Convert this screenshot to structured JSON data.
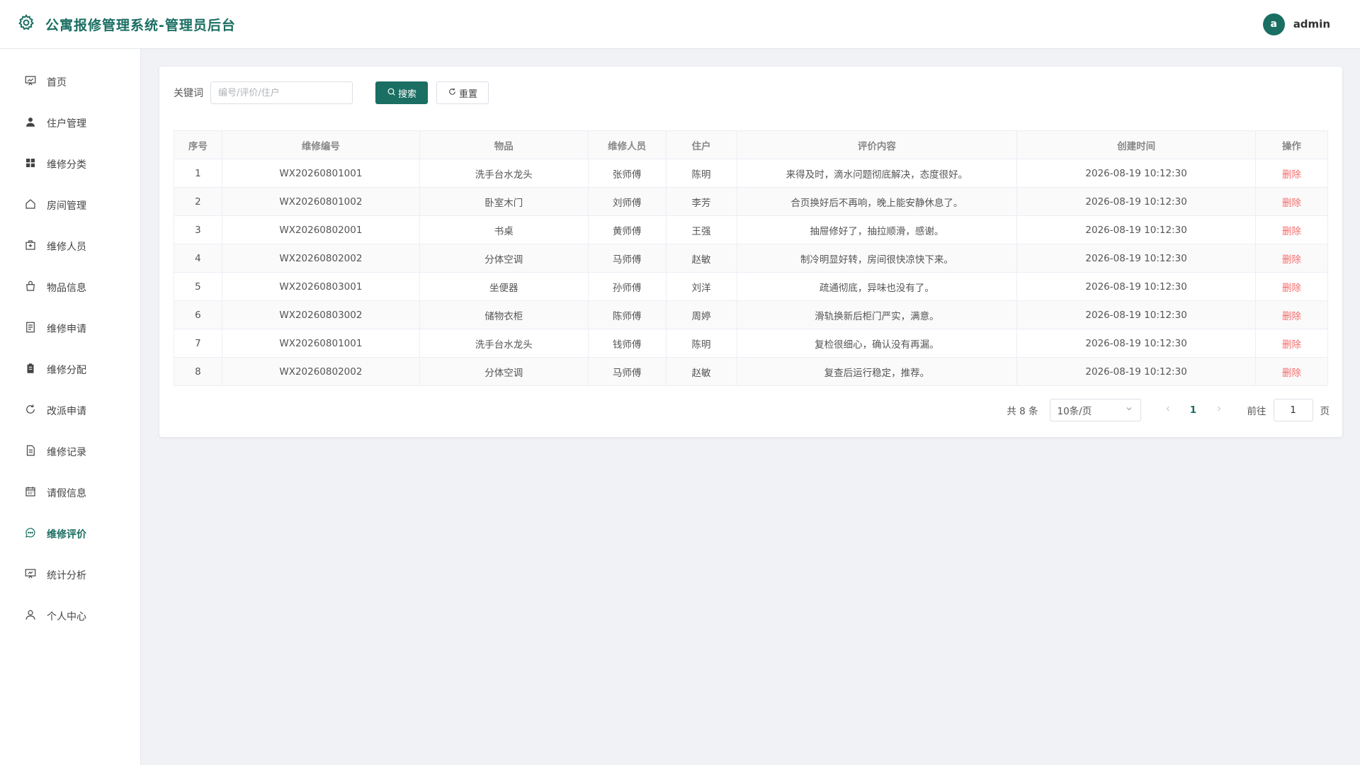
{
  "app": {
    "title": "公寓报修管理系统-管理员后台"
  },
  "user": {
    "initial": "a",
    "name": "admin"
  },
  "colors": {
    "primary": "#1a6e62",
    "danger": "#f56c6c"
  },
  "sidebar": {
    "items": [
      {
        "label": "首页",
        "icon": "chart-board-icon"
      },
      {
        "label": "住户管理",
        "icon": "user-filled-icon"
      },
      {
        "label": "维修分类",
        "icon": "grid-icon"
      },
      {
        "label": "房间管理",
        "icon": "house-icon"
      },
      {
        "label": "维修人员",
        "icon": "medical-kit-icon"
      },
      {
        "label": "物品信息",
        "icon": "shopping-bag-icon"
      },
      {
        "label": "维修申请",
        "icon": "document-icon"
      },
      {
        "label": "维修分配",
        "icon": "clipboard-icon"
      },
      {
        "label": "改派申请",
        "icon": "refresh-icon"
      },
      {
        "label": "维修记录",
        "icon": "file-text-icon"
      },
      {
        "label": "请假信息",
        "icon": "calendar-icon"
      },
      {
        "label": "维修评价",
        "icon": "chat-dots-icon"
      },
      {
        "label": "统计分析",
        "icon": "presentation-icon"
      },
      {
        "label": "个人中心",
        "icon": "user-icon"
      }
    ],
    "active_index": 11
  },
  "search": {
    "label": "关键词",
    "placeholder": "编号/评价/住户",
    "value": "",
    "search_label": "搜索",
    "reset_label": "重置"
  },
  "table": {
    "columns": [
      "序号",
      "维修编号",
      "物品",
      "维修人员",
      "住户",
      "评价内容",
      "创建时间",
      "操作"
    ],
    "rows": [
      [
        "1",
        "WX20260801001",
        "洗手台水龙头",
        "张师傅",
        "陈明",
        "来得及时，滴水问题彻底解决，态度很好。",
        "2026-08-19 10:12:30",
        "删除"
      ],
      [
        "2",
        "WX20260801002",
        "卧室木门",
        "刘师傅",
        "李芳",
        "合页换好后不再响，晚上能安静休息了。",
        "2026-08-19 10:12:30",
        "删除"
      ],
      [
        "3",
        "WX20260802001",
        "书桌",
        "黄师傅",
        "王强",
        "抽屉修好了，抽拉顺滑，感谢。",
        "2026-08-19 10:12:30",
        "删除"
      ],
      [
        "4",
        "WX20260802002",
        "分体空调",
        "马师傅",
        "赵敏",
        "制冷明显好转，房间很快凉快下来。",
        "2026-08-19 10:12:30",
        "删除"
      ],
      [
        "5",
        "WX20260803001",
        "坐便器",
        "孙师傅",
        "刘洋",
        "疏通彻底，异味也没有了。",
        "2026-08-19 10:12:30",
        "删除"
      ],
      [
        "6",
        "WX20260803002",
        "储物衣柜",
        "陈师傅",
        "周婷",
        "滑轨换新后柜门严实，满意。",
        "2026-08-19 10:12:30",
        "删除"
      ],
      [
        "7",
        "WX20260801001",
        "洗手台水龙头",
        "钱师傅",
        "陈明",
        "复检很细心，确认没有再漏。",
        "2026-08-19 10:12:30",
        "删除"
      ],
      [
        "8",
        "WX20260802002",
        "分体空调",
        "马师傅",
        "赵敏",
        "复查后运行稳定，推荐。",
        "2026-08-19 10:12:30",
        "删除"
      ]
    ]
  },
  "pagination": {
    "total_text": "共 8 条",
    "page_size": "10条/页",
    "current_page": "1",
    "goto_prefix": "前往",
    "goto_value": "1",
    "goto_suffix": "页"
  }
}
